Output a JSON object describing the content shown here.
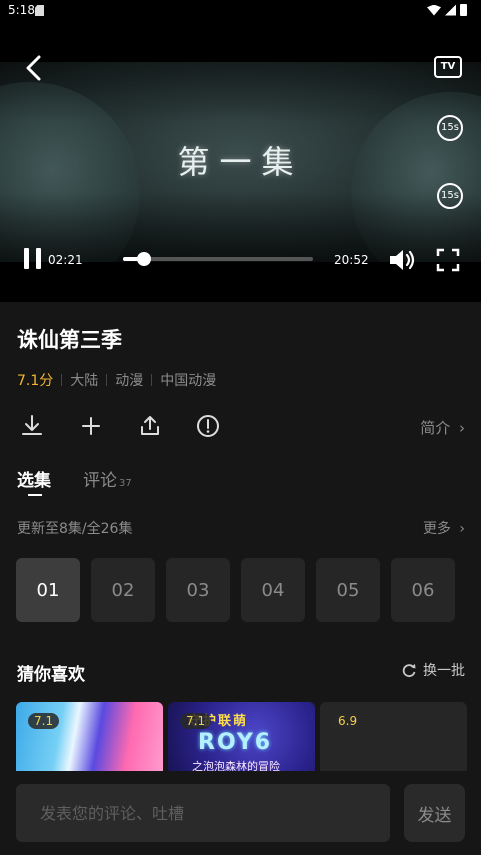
{
  "status_bar": {
    "time": "5:18"
  },
  "player": {
    "episode_title": "第一集",
    "current_time": "02:21",
    "total_time": "20:52",
    "progress": 0.113,
    "tv_label": "TV",
    "skip_back_label": "15s",
    "skip_forward_label": "15s"
  },
  "show": {
    "title": "诛仙第三季",
    "score": "7.1分",
    "tags": [
      "大陆",
      "动漫",
      "中国动漫"
    ],
    "intro_label": "简介"
  },
  "tabs": [
    {
      "label": "选集",
      "count": ""
    },
    {
      "label": "评论",
      "count": "37"
    }
  ],
  "episodes": {
    "update_text": "更新至8集/全26集",
    "more_label": "更多",
    "items": [
      "01",
      "02",
      "03",
      "04",
      "05",
      "06"
    ],
    "selected": "01"
  },
  "recommend": {
    "title": "猜你喜欢",
    "refresh_label": "换一批",
    "items": [
      {
        "rating": "7.1"
      },
      {
        "rating": "7.1",
        "poster_text": "守护联萌",
        "poster_logo": "ROY6",
        "poster_sub": "之泡泡森林的冒险"
      },
      {
        "rating": "6.9"
      }
    ]
  },
  "comment_bar": {
    "placeholder": "发表您的评论、吐槽",
    "send_label": "发送"
  },
  "colors": {
    "accent_score": "#f2b631",
    "background": "#161616"
  }
}
